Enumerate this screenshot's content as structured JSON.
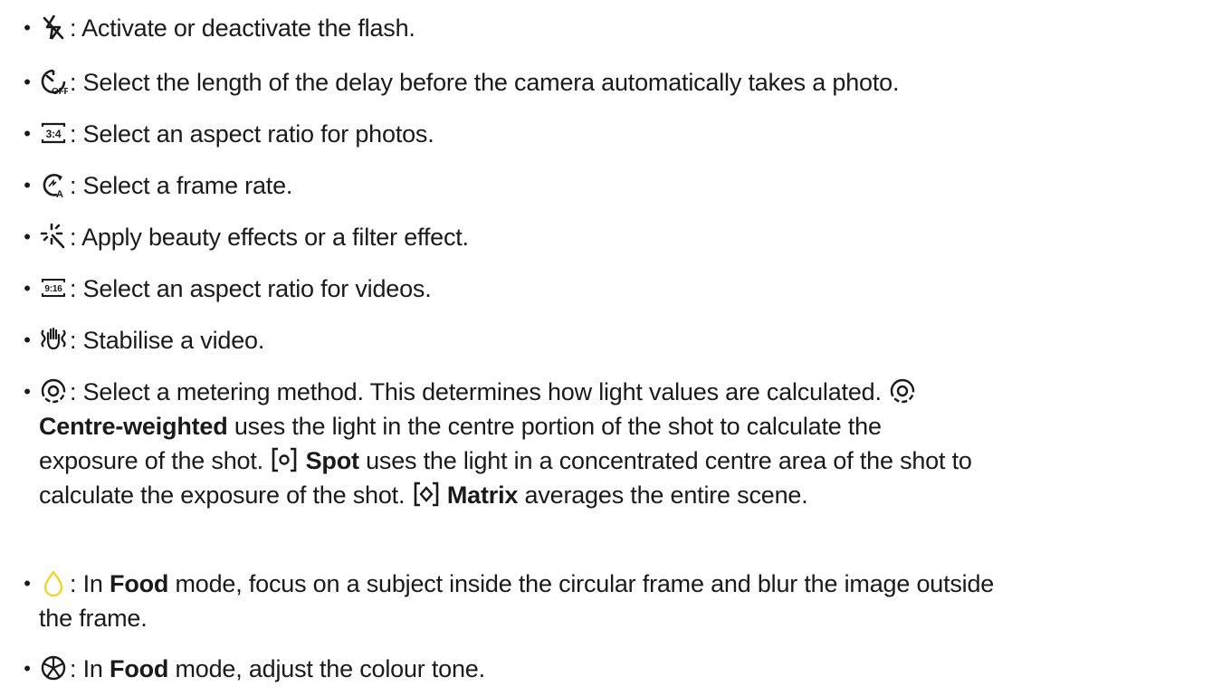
{
  "items": [
    {
      "icon": "flash-off-icon",
      "text": ": Activate or deactivate the flash."
    },
    {
      "icon": "timer-off-icon",
      "text": ": Select the length of the delay before the camera automatically takes a photo."
    },
    {
      "icon": "aspect-ratio-3-4-icon",
      "icon_label": "3:4",
      "text": ": Select an aspect ratio for photos."
    },
    {
      "icon": "frame-rate-auto-icon",
      "text": ": Select a frame rate."
    },
    {
      "icon": "sparkle-effects-icon",
      "text": ": Apply beauty effects or a filter effect."
    },
    {
      "icon": "aspect-ratio-9-16-icon",
      "icon_label": "9:16",
      "text": ": Select an aspect ratio for videos."
    },
    {
      "icon": "stabilise-hand-icon",
      "text": ": Stabilise a video."
    },
    {
      "icon": "metering-centre-weighted-icon",
      "line1": ": Select a metering method. This determines how light values are calculated.",
      "centre_weighted_bold": "Centre-weighted",
      "centre_weighted_text": " uses the light in the centre portion of the shot to calculate the",
      "line3_text": "exposure of the shot.",
      "spot_bold": "Spot",
      "spot_text": " uses the light in a concentrated centre area of the shot to",
      "line4_text": "calculate the exposure of the shot.",
      "matrix_bold": "Matrix",
      "matrix_text": " averages the entire scene."
    },
    {
      "icon": "drop-focus-icon",
      "prefix": ": In ",
      "bold": "Food",
      "suffix": " mode, focus on a subject inside the circular frame and blur the image outside",
      "line2": "the frame."
    },
    {
      "icon": "colour-tone-icon",
      "prefix": ": In ",
      "bold": "Food",
      "suffix": " mode, adjust the colour tone."
    }
  ],
  "colors": {
    "text": "#1a1a1a",
    "drop_icon": "#f2d21b"
  },
  "bullet": "•"
}
